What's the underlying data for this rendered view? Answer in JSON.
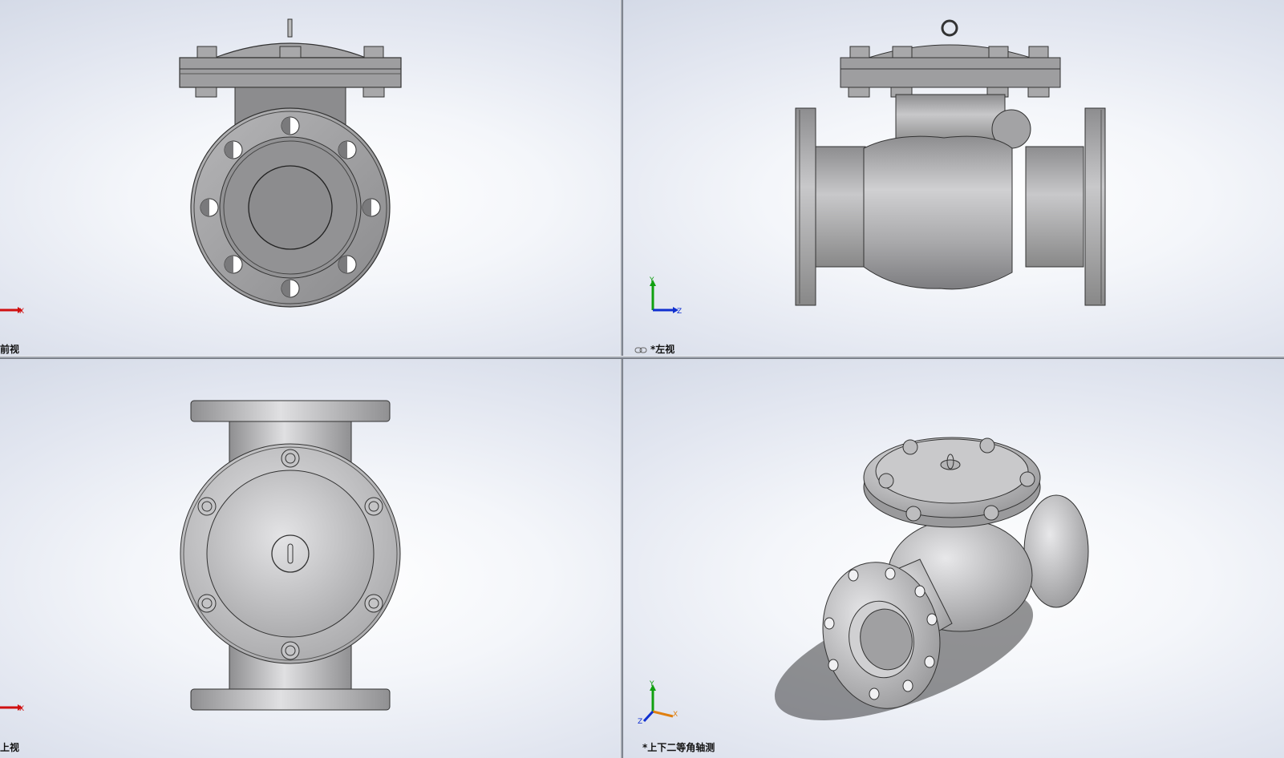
{
  "viewports": {
    "front": {
      "label": "前视"
    },
    "left": {
      "label": "*左视"
    },
    "top": {
      "label": "上视"
    },
    "iso": {
      "label": "*上下二等角轴测"
    }
  },
  "triad": {
    "x": "X",
    "y": "Y",
    "z": "Z"
  },
  "colors": {
    "background": "#e2e6f0",
    "metal": "#a9a9ab",
    "x_axis": "#d01010",
    "y_axis": "#10a010",
    "z_axis": "#1030d0"
  },
  "icons": {
    "link": "link-icon"
  }
}
